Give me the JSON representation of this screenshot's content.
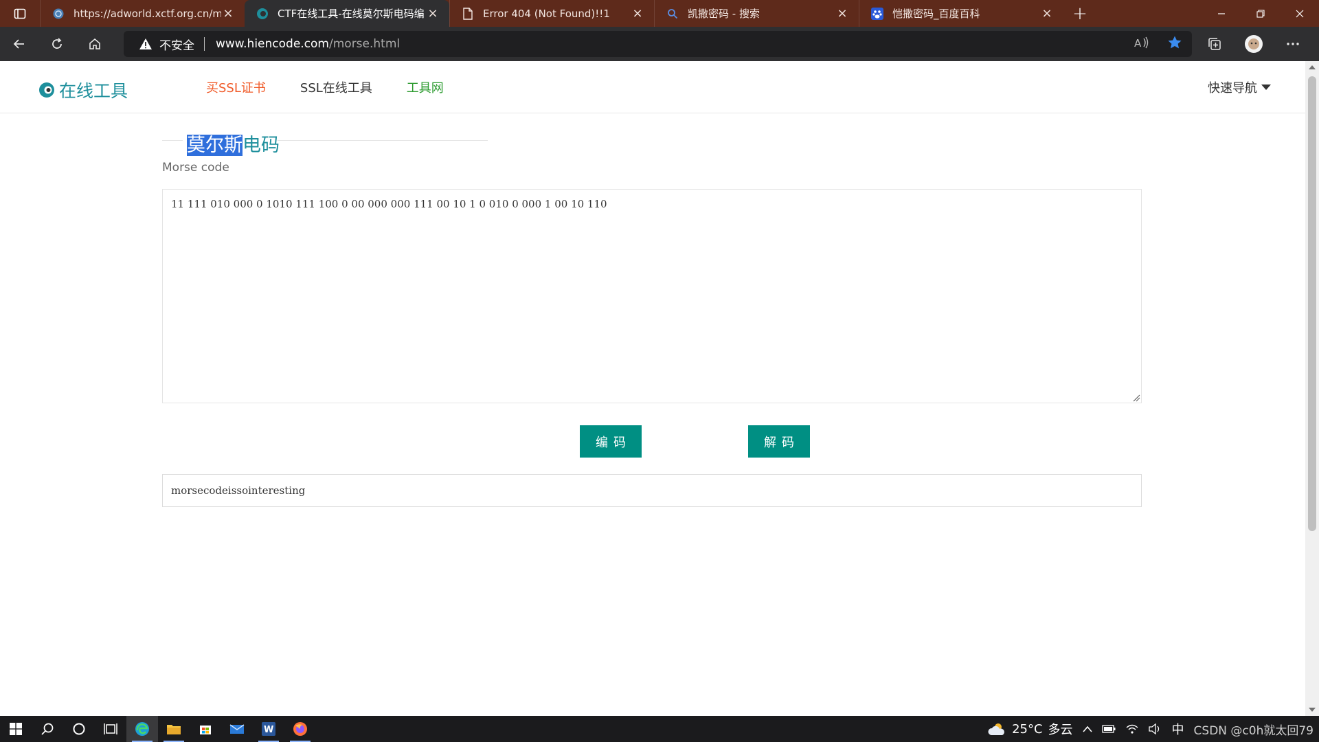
{
  "browser": {
    "tabs": [
      {
        "title": "https://adworld.xctf.org.cn/medi",
        "favicon": "globe-icon",
        "active": false
      },
      {
        "title": "CTF在线工具-在线莫尔斯电码编",
        "favicon": "hiencode-icon",
        "active": true
      },
      {
        "title": "Error 404 (Not Found)!!1",
        "favicon": "page-icon",
        "active": false
      },
      {
        "title": "凯撒密码 - 搜索",
        "favicon": "search-icon",
        "active": false
      },
      {
        "title": "恺撒密码_百度百科",
        "favicon": "baidu-icon",
        "active": false
      }
    ],
    "close_glyph": "×",
    "new_tab_glyph": "+",
    "address": {
      "security_label": "不安全",
      "url_host": "www.hiencode.com",
      "url_path": "/morse.html"
    }
  },
  "site": {
    "logo_text": "在线工具",
    "nav": {
      "buy_ssl": "买SSL证书",
      "ssl_tools": "SSL在线工具",
      "tools_site": "工具网"
    },
    "quick_nav": "快速导航"
  },
  "tool": {
    "title_highlight": "莫尔斯",
    "title_rest": "电码",
    "subtitle": "Morse code",
    "input_value": "11 111 010 000 0 1010 111 100 0 00 000 000 111 00 10 1 0 010 0 000 1 00 10 110",
    "encode_label": "编码",
    "decode_label": "解码",
    "output_value": "morsecodeissointeresting"
  },
  "taskbar": {
    "weather_temp": "25°C",
    "weather_desc": "多云",
    "ime": "中",
    "clock_text": "CSDN @c0h就太回79"
  },
  "colors": {
    "tab_strip": "#5e2a1b",
    "toolbar": "#2f2f31",
    "brand_teal": "#1e8f9c",
    "button_teal": "#008f83",
    "nav_orange": "#f05a28",
    "nav_green": "#2c9b2f",
    "selection": "#2f6fdc"
  }
}
